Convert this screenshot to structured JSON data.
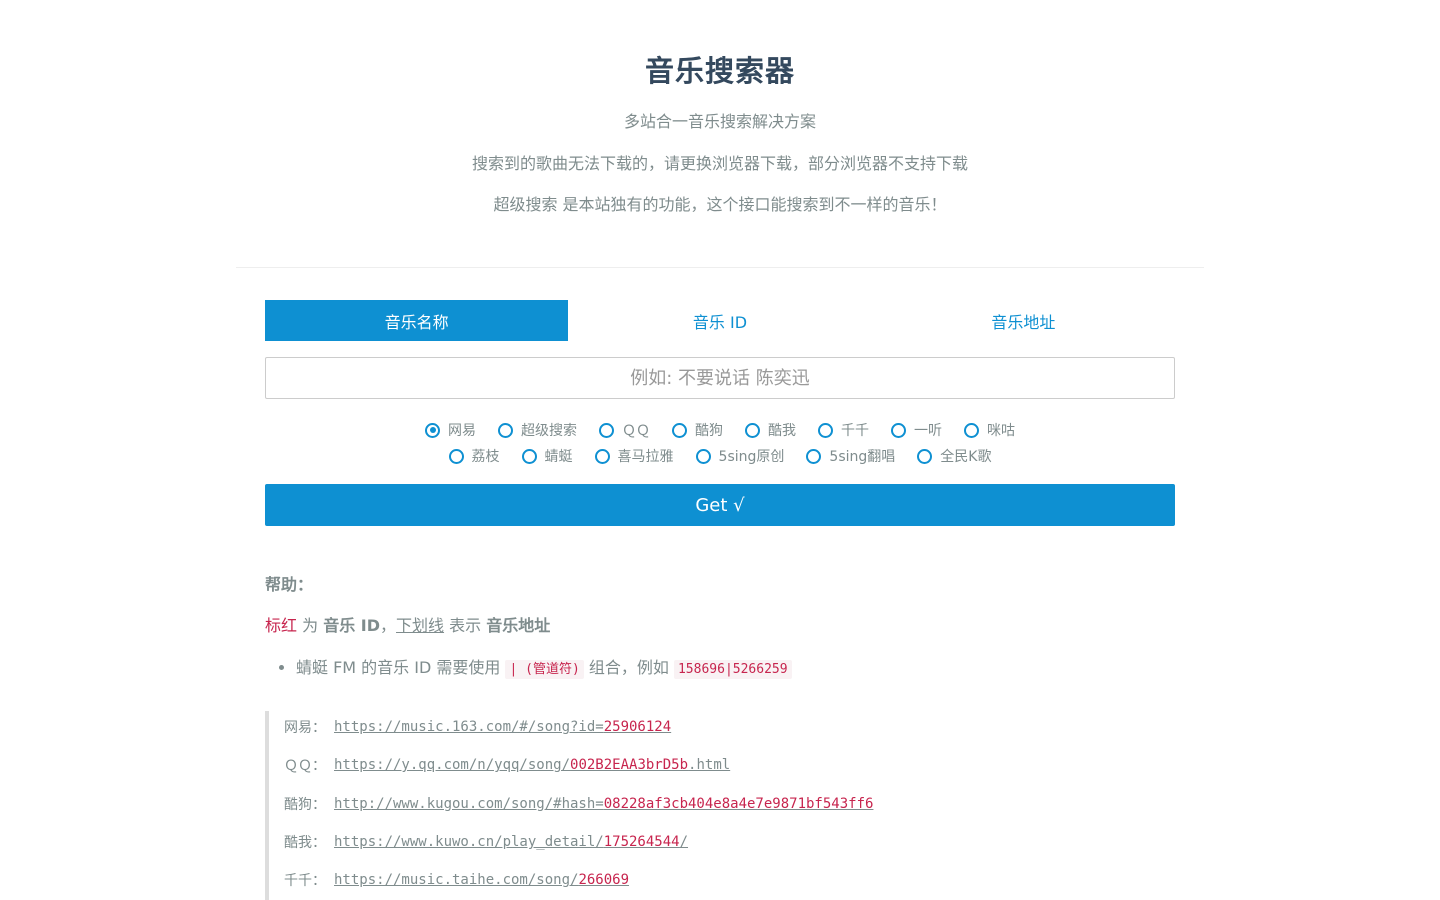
{
  "header": {
    "title": "音乐搜索器",
    "subtitle": "多站合一音乐搜索解决方案",
    "notice": "搜索到的歌曲无法下载的，请更换浏览器下载，部分浏览器不支持下载",
    "notice2": "超级搜索 是本站独有的功能，这个接口能搜索到不一样的音乐！"
  },
  "tabs": [
    {
      "label": "音乐名称",
      "active": true
    },
    {
      "label": "音乐 ID",
      "active": false
    },
    {
      "label": "音乐地址",
      "active": false
    }
  ],
  "search": {
    "placeholder": "例如: 不要说话 陈奕迅",
    "value": ""
  },
  "sources": {
    "row1": [
      {
        "label": "网易",
        "checked": true
      },
      {
        "label": "超级搜索",
        "checked": false
      },
      {
        "label": "ＱＱ",
        "checked": false
      },
      {
        "label": "酷狗",
        "checked": false
      },
      {
        "label": "酷我",
        "checked": false
      },
      {
        "label": "千千",
        "checked": false
      },
      {
        "label": "一听",
        "checked": false
      },
      {
        "label": "咪咕",
        "checked": false
      }
    ],
    "row2": [
      {
        "label": "荔枝",
        "checked": false
      },
      {
        "label": "蜻蜓",
        "checked": false
      },
      {
        "label": "喜马拉雅",
        "checked": false
      },
      {
        "label": "5sing原创",
        "checked": false
      },
      {
        "label": "5sing翻唱",
        "checked": false
      },
      {
        "label": "全民K歌",
        "checked": false
      }
    ]
  },
  "get_button": "Get √",
  "help": {
    "title": "帮助：",
    "legend": {
      "red": "标红",
      "is": " 为 ",
      "music_id": "音乐 ID",
      "comma": "，",
      "underline": "下划线",
      "means": " 表示 ",
      "music_url": "音乐地址"
    },
    "bullet": {
      "text1": "蜻蜓 FM 的音乐 ID 需要使用 ",
      "code1": "| (管道符)",
      "text2": " 组合，例如 ",
      "code2": "158696|5266259"
    },
    "examples": [
      {
        "label": "网易：",
        "prefix": "https://music.163.com/#/song?id=",
        "id": "25906124",
        "suffix": ""
      },
      {
        "label": "ＱＱ：",
        "prefix": "https://y.qq.com/n/yqq/song/",
        "id": "002B2EAA3brD5b",
        "suffix": ".html"
      },
      {
        "label": "酷狗：",
        "prefix": "http://www.kugou.com/song/#hash=",
        "id": "08228af3cb404e8a4e7e9871bf543ff6",
        "suffix": ""
      },
      {
        "label": "酷我：",
        "prefix": "https://www.kuwo.cn/play_detail/",
        "id": "175264544",
        "suffix": "/"
      },
      {
        "label": "千千：",
        "prefix": "https://music.taihe.com/song/",
        "id": "266069",
        "suffix": ""
      }
    ]
  },
  "colors": {
    "accent": "#0e90d2",
    "title": "#34495e",
    "text": "#7f8c8d",
    "code": "#c7254e"
  }
}
